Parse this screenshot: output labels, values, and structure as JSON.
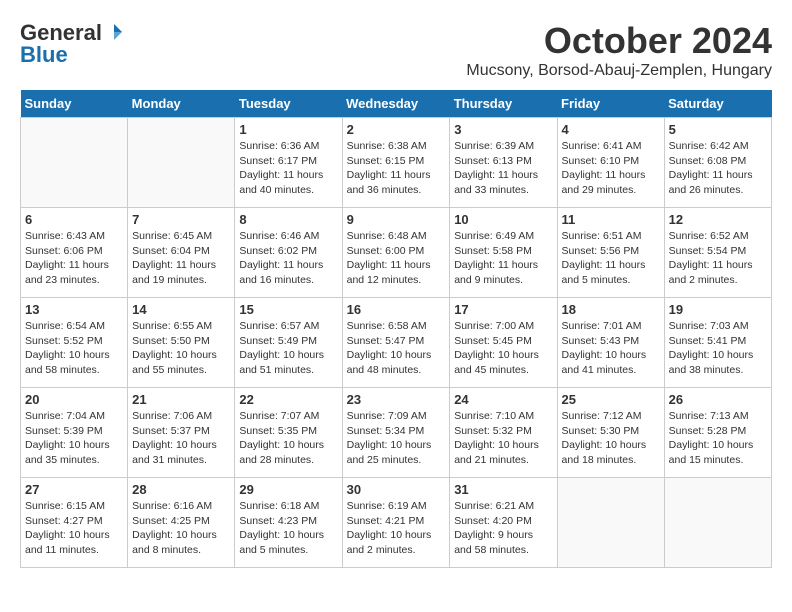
{
  "header": {
    "logo_general": "General",
    "logo_blue": "Blue",
    "month_title": "October 2024",
    "subtitle": "Mucsony, Borsod-Abauj-Zemplen, Hungary"
  },
  "days_of_week": [
    "Sunday",
    "Monday",
    "Tuesday",
    "Wednesday",
    "Thursday",
    "Friday",
    "Saturday"
  ],
  "weeks": [
    [
      {
        "day": "",
        "sunrise": "",
        "sunset": "",
        "daylight": ""
      },
      {
        "day": "",
        "sunrise": "",
        "sunset": "",
        "daylight": ""
      },
      {
        "day": "1",
        "sunrise": "Sunrise: 6:36 AM",
        "sunset": "Sunset: 6:17 PM",
        "daylight": "Daylight: 11 hours and 40 minutes."
      },
      {
        "day": "2",
        "sunrise": "Sunrise: 6:38 AM",
        "sunset": "Sunset: 6:15 PM",
        "daylight": "Daylight: 11 hours and 36 minutes."
      },
      {
        "day": "3",
        "sunrise": "Sunrise: 6:39 AM",
        "sunset": "Sunset: 6:13 PM",
        "daylight": "Daylight: 11 hours and 33 minutes."
      },
      {
        "day": "4",
        "sunrise": "Sunrise: 6:41 AM",
        "sunset": "Sunset: 6:10 PM",
        "daylight": "Daylight: 11 hours and 29 minutes."
      },
      {
        "day": "5",
        "sunrise": "Sunrise: 6:42 AM",
        "sunset": "Sunset: 6:08 PM",
        "daylight": "Daylight: 11 hours and 26 minutes."
      }
    ],
    [
      {
        "day": "6",
        "sunrise": "Sunrise: 6:43 AM",
        "sunset": "Sunset: 6:06 PM",
        "daylight": "Daylight: 11 hours and 23 minutes."
      },
      {
        "day": "7",
        "sunrise": "Sunrise: 6:45 AM",
        "sunset": "Sunset: 6:04 PM",
        "daylight": "Daylight: 11 hours and 19 minutes."
      },
      {
        "day": "8",
        "sunrise": "Sunrise: 6:46 AM",
        "sunset": "Sunset: 6:02 PM",
        "daylight": "Daylight: 11 hours and 16 minutes."
      },
      {
        "day": "9",
        "sunrise": "Sunrise: 6:48 AM",
        "sunset": "Sunset: 6:00 PM",
        "daylight": "Daylight: 11 hours and 12 minutes."
      },
      {
        "day": "10",
        "sunrise": "Sunrise: 6:49 AM",
        "sunset": "Sunset: 5:58 PM",
        "daylight": "Daylight: 11 hours and 9 minutes."
      },
      {
        "day": "11",
        "sunrise": "Sunrise: 6:51 AM",
        "sunset": "Sunset: 5:56 PM",
        "daylight": "Daylight: 11 hours and 5 minutes."
      },
      {
        "day": "12",
        "sunrise": "Sunrise: 6:52 AM",
        "sunset": "Sunset: 5:54 PM",
        "daylight": "Daylight: 11 hours and 2 minutes."
      }
    ],
    [
      {
        "day": "13",
        "sunrise": "Sunrise: 6:54 AM",
        "sunset": "Sunset: 5:52 PM",
        "daylight": "Daylight: 10 hours and 58 minutes."
      },
      {
        "day": "14",
        "sunrise": "Sunrise: 6:55 AM",
        "sunset": "Sunset: 5:50 PM",
        "daylight": "Daylight: 10 hours and 55 minutes."
      },
      {
        "day": "15",
        "sunrise": "Sunrise: 6:57 AM",
        "sunset": "Sunset: 5:49 PM",
        "daylight": "Daylight: 10 hours and 51 minutes."
      },
      {
        "day": "16",
        "sunrise": "Sunrise: 6:58 AM",
        "sunset": "Sunset: 5:47 PM",
        "daylight": "Daylight: 10 hours and 48 minutes."
      },
      {
        "day": "17",
        "sunrise": "Sunrise: 7:00 AM",
        "sunset": "Sunset: 5:45 PM",
        "daylight": "Daylight: 10 hours and 45 minutes."
      },
      {
        "day": "18",
        "sunrise": "Sunrise: 7:01 AM",
        "sunset": "Sunset: 5:43 PM",
        "daylight": "Daylight: 10 hours and 41 minutes."
      },
      {
        "day": "19",
        "sunrise": "Sunrise: 7:03 AM",
        "sunset": "Sunset: 5:41 PM",
        "daylight": "Daylight: 10 hours and 38 minutes."
      }
    ],
    [
      {
        "day": "20",
        "sunrise": "Sunrise: 7:04 AM",
        "sunset": "Sunset: 5:39 PM",
        "daylight": "Daylight: 10 hours and 35 minutes."
      },
      {
        "day": "21",
        "sunrise": "Sunrise: 7:06 AM",
        "sunset": "Sunset: 5:37 PM",
        "daylight": "Daylight: 10 hours and 31 minutes."
      },
      {
        "day": "22",
        "sunrise": "Sunrise: 7:07 AM",
        "sunset": "Sunset: 5:35 PM",
        "daylight": "Daylight: 10 hours and 28 minutes."
      },
      {
        "day": "23",
        "sunrise": "Sunrise: 7:09 AM",
        "sunset": "Sunset: 5:34 PM",
        "daylight": "Daylight: 10 hours and 25 minutes."
      },
      {
        "day": "24",
        "sunrise": "Sunrise: 7:10 AM",
        "sunset": "Sunset: 5:32 PM",
        "daylight": "Daylight: 10 hours and 21 minutes."
      },
      {
        "day": "25",
        "sunrise": "Sunrise: 7:12 AM",
        "sunset": "Sunset: 5:30 PM",
        "daylight": "Daylight: 10 hours and 18 minutes."
      },
      {
        "day": "26",
        "sunrise": "Sunrise: 7:13 AM",
        "sunset": "Sunset: 5:28 PM",
        "daylight": "Daylight: 10 hours and 15 minutes."
      }
    ],
    [
      {
        "day": "27",
        "sunrise": "Sunrise: 6:15 AM",
        "sunset": "Sunset: 4:27 PM",
        "daylight": "Daylight: 10 hours and 11 minutes."
      },
      {
        "day": "28",
        "sunrise": "Sunrise: 6:16 AM",
        "sunset": "Sunset: 4:25 PM",
        "daylight": "Daylight: 10 hours and 8 minutes."
      },
      {
        "day": "29",
        "sunrise": "Sunrise: 6:18 AM",
        "sunset": "Sunset: 4:23 PM",
        "daylight": "Daylight: 10 hours and 5 minutes."
      },
      {
        "day": "30",
        "sunrise": "Sunrise: 6:19 AM",
        "sunset": "Sunset: 4:21 PM",
        "daylight": "Daylight: 10 hours and 2 minutes."
      },
      {
        "day": "31",
        "sunrise": "Sunrise: 6:21 AM",
        "sunset": "Sunset: 4:20 PM",
        "daylight": "Daylight: 9 hours and 58 minutes."
      },
      {
        "day": "",
        "sunrise": "",
        "sunset": "",
        "daylight": ""
      },
      {
        "day": "",
        "sunrise": "",
        "sunset": "",
        "daylight": ""
      }
    ]
  ]
}
